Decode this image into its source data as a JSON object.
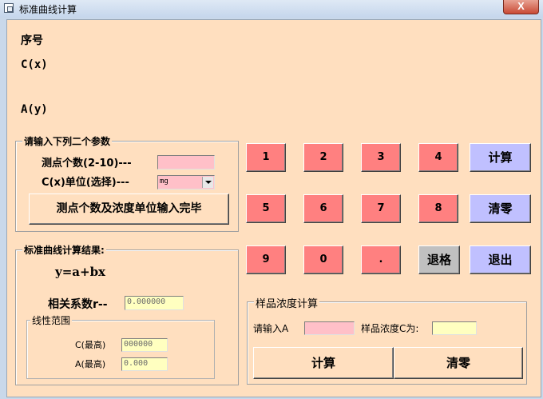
{
  "window": {
    "title": "标准曲线计算",
    "close_glyph": "X"
  },
  "display": {
    "seq_label": "序号",
    "cx_label": "C(x)",
    "ay_label": "A(y)"
  },
  "params": {
    "group_title": "请输入下列二个参数",
    "points_label": "测点个数(2-10)---",
    "points_value": "",
    "unit_label": "C(x)单位(选择)---",
    "unit_value": "mg",
    "confirm_label": "测点个数及浓度单位输入完毕"
  },
  "keypad": {
    "keys": [
      "1",
      "2",
      "3",
      "4",
      "5",
      "6",
      "7",
      "8",
      "9",
      "0",
      "."
    ],
    "calc_label": "计算",
    "clear_label": "清零",
    "backspace_label": "退格",
    "exit_label": "退出"
  },
  "result": {
    "group_title": "标准曲线计算结果:",
    "equation": "y=a+bx",
    "r_label": "相关系数r--",
    "r_value": "0.000000",
    "range_title": "线性范围",
    "c_max_label": "C(最高)",
    "c_max_value": "000000",
    "a_max_label": "A(最高)",
    "a_max_value": "0.000"
  },
  "sample": {
    "group_title": "样品浓度计算",
    "input_label": "请输入A",
    "input_value": "",
    "output_label": "样品浓度C为:",
    "output_value": "",
    "calc_label": "计算",
    "clear_label": "清零"
  },
  "colors": {
    "background": "#ffdfbf",
    "number_key": "#ff8080",
    "action_key": "#c0c0ff",
    "backspace_key": "#c0c0c0",
    "input_pink": "#ffc0c8",
    "output_yellow": "#ffffc0"
  },
  "icons": {
    "app": "window-app-icon",
    "close": "close-icon",
    "dropdown": "chevron-down-icon"
  }
}
